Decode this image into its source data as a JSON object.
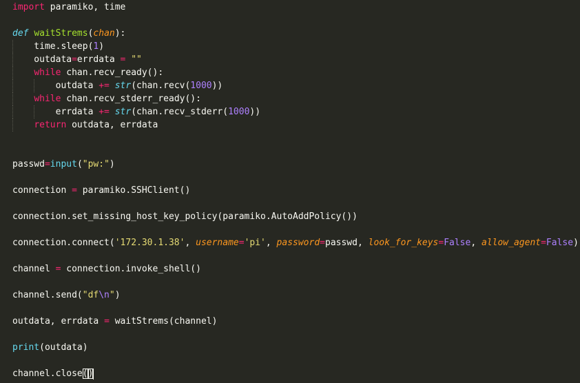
{
  "editor": {
    "theme": "monokai",
    "colors": {
      "background": "#272822",
      "active_line": "#3e3d32",
      "keyword": "#f92672",
      "function": "#a6e22e",
      "parameter": "#fd971f",
      "string": "#e6db74",
      "number": "#ae81ff",
      "builtin": "#66d9ef",
      "text": "#f8f8f2"
    },
    "active_line_number": 30,
    "lines": [
      [
        {
          "t": "kw",
          "v": "import"
        },
        {
          "t": "plain",
          "v": " paramiko, time"
        }
      ],
      [],
      [
        {
          "t": "def",
          "v": "def"
        },
        {
          "t": "plain",
          "v": " "
        },
        {
          "t": "fn",
          "v": "waitStrems"
        },
        {
          "t": "plain",
          "v": "("
        },
        {
          "t": "param",
          "v": "chan"
        },
        {
          "t": "plain",
          "v": "):"
        }
      ],
      [
        {
          "t": "plain",
          "v": "    time.sleep("
        },
        {
          "t": "num",
          "v": "1"
        },
        {
          "t": "plain",
          "v": ")"
        }
      ],
      [
        {
          "t": "plain",
          "v": "    outdata"
        },
        {
          "t": "op",
          "v": "="
        },
        {
          "t": "plain",
          "v": "errdata "
        },
        {
          "t": "op",
          "v": "="
        },
        {
          "t": "plain",
          "v": " "
        },
        {
          "t": "str",
          "v": "\"\""
        }
      ],
      [
        {
          "t": "plain",
          "v": "    "
        },
        {
          "t": "kw",
          "v": "while"
        },
        {
          "t": "plain",
          "v": " chan.recv_ready():"
        }
      ],
      [
        {
          "t": "plain",
          "v": "        outdata "
        },
        {
          "t": "op",
          "v": "+="
        },
        {
          "t": "plain",
          "v": " "
        },
        {
          "t": "builtin-i",
          "v": "str"
        },
        {
          "t": "plain",
          "v": "(chan.recv("
        },
        {
          "t": "num",
          "v": "1000"
        },
        {
          "t": "plain",
          "v": "))"
        }
      ],
      [
        {
          "t": "plain",
          "v": "    "
        },
        {
          "t": "kw",
          "v": "while"
        },
        {
          "t": "plain",
          "v": " chan.recv_stderr_ready():"
        }
      ],
      [
        {
          "t": "plain",
          "v": "        errdata "
        },
        {
          "t": "op",
          "v": "+="
        },
        {
          "t": "plain",
          "v": " "
        },
        {
          "t": "builtin-i",
          "v": "str"
        },
        {
          "t": "plain",
          "v": "(chan.recv_stderr("
        },
        {
          "t": "num",
          "v": "1000"
        },
        {
          "t": "plain",
          "v": "))"
        }
      ],
      [
        {
          "t": "plain",
          "v": "    "
        },
        {
          "t": "kw",
          "v": "return"
        },
        {
          "t": "plain",
          "v": " outdata, errdata"
        }
      ],
      [],
      [],
      [
        {
          "t": "plain",
          "v": "passwd"
        },
        {
          "t": "op",
          "v": "="
        },
        {
          "t": "builtin",
          "v": "input"
        },
        {
          "t": "plain",
          "v": "("
        },
        {
          "t": "str",
          "v": "\"pw:\""
        },
        {
          "t": "plain",
          "v": ")"
        }
      ],
      [],
      [
        {
          "t": "plain",
          "v": "connection "
        },
        {
          "t": "op",
          "v": "="
        },
        {
          "t": "plain",
          "v": " paramiko.SSHClient()"
        }
      ],
      [],
      [
        {
          "t": "plain",
          "v": "connection.set_missing_host_key_policy(paramiko.AutoAddPolicy())"
        }
      ],
      [],
      [
        {
          "t": "plain",
          "v": "connection.connect("
        },
        {
          "t": "str",
          "v": "'172.30.1.38'"
        },
        {
          "t": "plain",
          "v": ", "
        },
        {
          "t": "param",
          "v": "username"
        },
        {
          "t": "op",
          "v": "="
        },
        {
          "t": "str",
          "v": "'pi'"
        },
        {
          "t": "plain",
          "v": ", "
        },
        {
          "t": "param",
          "v": "password"
        },
        {
          "t": "op",
          "v": "="
        },
        {
          "t": "plain",
          "v": "passwd, "
        },
        {
          "t": "param",
          "v": "look_for_keys"
        },
        {
          "t": "op",
          "v": "="
        },
        {
          "t": "const",
          "v": "False"
        },
        {
          "t": "plain",
          "v": ", "
        },
        {
          "t": "param",
          "v": "allow_agent"
        },
        {
          "t": "op",
          "v": "="
        },
        {
          "t": "const",
          "v": "False"
        },
        {
          "t": "plain",
          "v": ")"
        }
      ],
      [],
      [
        {
          "t": "plain",
          "v": "channel "
        },
        {
          "t": "op",
          "v": "="
        },
        {
          "t": "plain",
          "v": " connection.invoke_shell()"
        }
      ],
      [],
      [
        {
          "t": "plain",
          "v": "channel.send("
        },
        {
          "t": "str",
          "v": "\"df"
        },
        {
          "t": "esc",
          "v": "\\n"
        },
        {
          "t": "str",
          "v": "\""
        },
        {
          "t": "plain",
          "v": ")"
        }
      ],
      [],
      [
        {
          "t": "plain",
          "v": "outdata, errdata "
        },
        {
          "t": "op",
          "v": "="
        },
        {
          "t": "plain",
          "v": " waitStrems(channel)"
        }
      ],
      [],
      [
        {
          "t": "builtin",
          "v": "print"
        },
        {
          "t": "plain",
          "v": "(outdata)"
        }
      ],
      [],
      [
        {
          "t": "plain",
          "v": "channel.close"
        },
        {
          "t": "bracket",
          "v": "("
        },
        {
          "t": "bracket",
          "v": ")"
        },
        {
          "t": "cursor",
          "v": ""
        }
      ]
    ]
  }
}
